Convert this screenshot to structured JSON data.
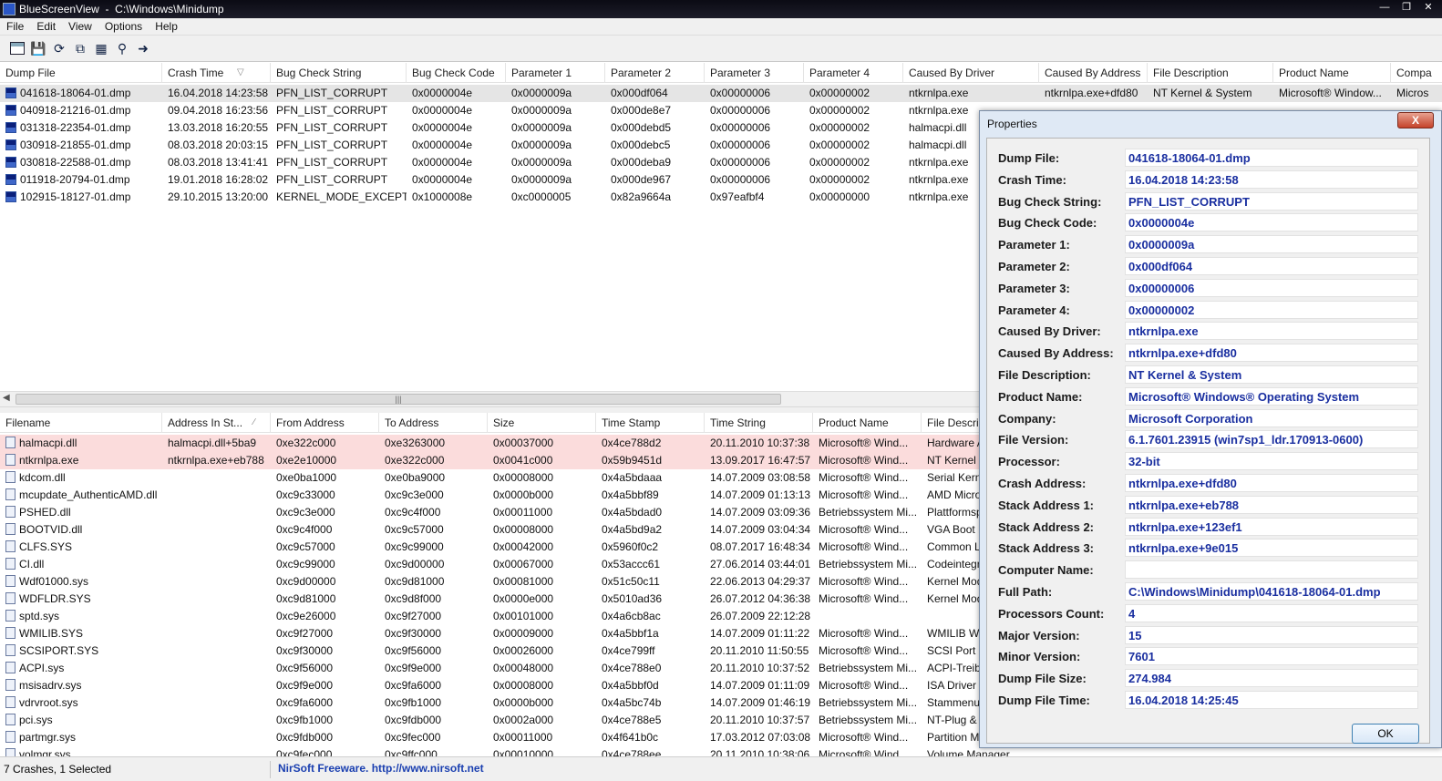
{
  "window": {
    "title": "BlueScreenView  -  C:\\Windows\\Minidump"
  },
  "menu": [
    "File",
    "Edit",
    "View",
    "Options",
    "Help"
  ],
  "toolbar_icons": [
    "properties-icon",
    "save-icon",
    "refresh-icon",
    "copy-icon",
    "report-icon",
    "find-icon",
    "exit-icon"
  ],
  "top_columns": [
    "Dump File",
    "Crash Time",
    "Bug Check String",
    "Bug Check Code",
    "Parameter 1",
    "Parameter 2",
    "Parameter 3",
    "Parameter 4",
    "Caused By Driver",
    "Caused By Address",
    "File Description",
    "Product Name",
    "Compa"
  ],
  "dumps": [
    [
      "041618-18064-01.dmp",
      "16.04.2018 14:23:58",
      "PFN_LIST_CORRUPT",
      "0x0000004e",
      "0x0000009a",
      "0x000df064",
      "0x00000006",
      "0x00000002",
      "ntkrnlpa.exe",
      "ntkrnlpa.exe+dfd80",
      "NT Kernel & System",
      "Microsoft® Window...",
      "Micros"
    ],
    [
      "040918-21216-01.dmp",
      "09.04.2018 16:23:56",
      "PFN_LIST_CORRUPT",
      "0x0000004e",
      "0x0000009a",
      "0x000de8e7",
      "0x00000006",
      "0x00000002",
      "ntkrnlpa.exe",
      "",
      "",
      "",
      ""
    ],
    [
      "031318-22354-01.dmp",
      "13.03.2018 16:20:55",
      "PFN_LIST_CORRUPT",
      "0x0000004e",
      "0x0000009a",
      "0x000debd5",
      "0x00000006",
      "0x00000002",
      "halmacpi.dll",
      "",
      "",
      "",
      ""
    ],
    [
      "030918-21855-01.dmp",
      "08.03.2018 20:03:15",
      "PFN_LIST_CORRUPT",
      "0x0000004e",
      "0x0000009a",
      "0x000debc5",
      "0x00000006",
      "0x00000002",
      "halmacpi.dll",
      "",
      "",
      "",
      ""
    ],
    [
      "030818-22588-01.dmp",
      "08.03.2018 13:41:41",
      "PFN_LIST_CORRUPT",
      "0x0000004e",
      "0x0000009a",
      "0x000deba9",
      "0x00000006",
      "0x00000002",
      "ntkrnlpa.exe",
      "",
      "",
      "",
      ""
    ],
    [
      "011918-20794-01.dmp",
      "19.01.2018 16:28:02",
      "PFN_LIST_CORRUPT",
      "0x0000004e",
      "0x0000009a",
      "0x000de967",
      "0x00000006",
      "0x00000002",
      "ntkrnlpa.exe",
      "",
      "",
      "",
      ""
    ],
    [
      "102915-18127-01.dmp",
      "29.10.2015 13:20:00",
      "KERNEL_MODE_EXCEPTI...",
      "0x1000008e",
      "0xc0000005",
      "0x82a9664a",
      "0x97eafbf4",
      "0x00000000",
      "ntkrnlpa.exe",
      "",
      "",
      "",
      ""
    ]
  ],
  "bottom_columns": [
    "Filename",
    "Address In St...",
    "From Address",
    "To Address",
    "Size",
    "Time Stamp",
    "Time String",
    "Product Name",
    "File Descrip"
  ],
  "drivers": [
    [
      "halmacpi.dll",
      "halmacpi.dll+5ba9",
      "0xe322c000",
      "0xe3263000",
      "0x00037000",
      "0x4ce788d2",
      "20.11.2010 10:37:38",
      "Microsoft® Wind...",
      "Hardware A"
    ],
    [
      "ntkrnlpa.exe",
      "ntkrnlpa.exe+eb788",
      "0xe2e10000",
      "0xe322c000",
      "0x0041c000",
      "0x59b9451d",
      "13.09.2017 16:47:57",
      "Microsoft® Wind...",
      "NT Kernel"
    ],
    [
      "kdcom.dll",
      "",
      "0xe0ba1000",
      "0xe0ba9000",
      "0x00008000",
      "0x4a5bdaaa",
      "14.07.2009 03:08:58",
      "Microsoft® Wind...",
      "Serial Kerne"
    ],
    [
      "mcupdate_AuthenticAMD.dll",
      "",
      "0xc9c33000",
      "0xc9c3e000",
      "0x0000b000",
      "0x4a5bbf89",
      "14.07.2009 01:13:13",
      "Microsoft® Wind...",
      "AMD Micro"
    ],
    [
      "PSHED.dll",
      "",
      "0xc9c3e000",
      "0xc9c4f000",
      "0x00011000",
      "0x4a5bdad0",
      "14.07.2009 03:09:36",
      "Betriebssystem Mi...",
      "Plattformsp"
    ],
    [
      "BOOTVID.dll",
      "",
      "0xc9c4f000",
      "0xc9c57000",
      "0x00008000",
      "0x4a5bd9a2",
      "14.07.2009 03:04:34",
      "Microsoft® Wind...",
      "VGA Boot D"
    ],
    [
      "CLFS.SYS",
      "",
      "0xc9c57000",
      "0xc9c99000",
      "0x00042000",
      "0x5960f0c2",
      "08.07.2017 16:48:34",
      "Microsoft® Wind...",
      "Common L"
    ],
    [
      "CI.dll",
      "",
      "0xc9c99000",
      "0xc9d00000",
      "0x00067000",
      "0x53accc61",
      "27.06.2014 03:44:01",
      "Betriebssystem Mi...",
      "Codeintegr"
    ],
    [
      "Wdf01000.sys",
      "",
      "0xc9d00000",
      "0xc9d81000",
      "0x00081000",
      "0x51c50c11",
      "22.06.2013 04:29:37",
      "Microsoft® Wind...",
      "Kernel Mod"
    ],
    [
      "WDFLDR.SYS",
      "",
      "0xc9d81000",
      "0xc9d8f000",
      "0x0000e000",
      "0x5010ad36",
      "26.07.2012 04:36:38",
      "Microsoft® Wind...",
      "Kernel Mod"
    ],
    [
      "sptd.sys",
      "",
      "0xc9e26000",
      "0xc9f27000",
      "0x00101000",
      "0x4a6cb8ac",
      "26.07.2009 22:12:28",
      "",
      ""
    ],
    [
      "WMILIB.SYS",
      "",
      "0xc9f27000",
      "0xc9f30000",
      "0x00009000",
      "0x4a5bbf1a",
      "14.07.2009 01:11:22",
      "Microsoft® Wind...",
      "WMILIB WI"
    ],
    [
      "SCSIPORT.SYS",
      "",
      "0xc9f30000",
      "0xc9f56000",
      "0x00026000",
      "0x4ce799ff",
      "20.11.2010 11:50:55",
      "Microsoft® Wind...",
      "SCSI Port D"
    ],
    [
      "ACPI.sys",
      "",
      "0xc9f56000",
      "0xc9f9e000",
      "0x00048000",
      "0x4ce788e0",
      "20.11.2010 10:37:52",
      "Betriebssystem Mi...",
      "ACPI-Treib"
    ],
    [
      "msisadrv.sys",
      "",
      "0xc9f9e000",
      "0xc9fa6000",
      "0x00008000",
      "0x4a5bbf0d",
      "14.07.2009 01:11:09",
      "Microsoft® Wind...",
      "ISA Driver"
    ],
    [
      "vdrvroot.sys",
      "",
      "0xc9fa6000",
      "0xc9fb1000",
      "0x0000b000",
      "0x4a5bc74b",
      "14.07.2009 01:46:19",
      "Betriebssystem Mi...",
      "Stammenu"
    ],
    [
      "pci.sys",
      "",
      "0xc9fb1000",
      "0xc9fdb000",
      "0x0002a000",
      "0x4ce788e5",
      "20.11.2010 10:37:57",
      "Betriebssystem Mi...",
      "NT-Plug &"
    ],
    [
      "partmgr.sys",
      "",
      "0xc9fdb000",
      "0xc9fec000",
      "0x00011000",
      "0x4f641b0c",
      "17.03.2012 07:03:08",
      "Microsoft® Wind...",
      "Partition M"
    ],
    [
      "volmgr.sys",
      "",
      "0xc9fec000",
      "0xc9ffc000",
      "0x00010000",
      "0x4ce788ee",
      "20.11.2010 10:38:06",
      "Microsoft® Wind...",
      "Volume Manager"
    ]
  ],
  "status": {
    "count": "7 Crashes, 1 Selected",
    "link": "NirSoft Freeware.  http://www.nirsoft.net"
  },
  "dialog": {
    "title": "Properties",
    "close": "X",
    "ok": "OK",
    "props": [
      {
        "label": "Dump File:",
        "value": "041618-18064-01.dmp"
      },
      {
        "label": "Crash Time:",
        "value": "16.04.2018 14:23:58"
      },
      {
        "label": "Bug Check String:",
        "value": "PFN_LIST_CORRUPT"
      },
      {
        "label": "Bug Check Code:",
        "value": "0x0000004e"
      },
      {
        "label": "Parameter 1:",
        "value": "0x0000009a"
      },
      {
        "label": "Parameter 2:",
        "value": "0x000df064"
      },
      {
        "label": "Parameter 3:",
        "value": "0x00000006"
      },
      {
        "label": "Parameter 4:",
        "value": "0x00000002"
      },
      {
        "label": "Caused By Driver:",
        "value": "ntkrnlpa.exe"
      },
      {
        "label": "Caused By Address:",
        "value": "ntkrnlpa.exe+dfd80"
      },
      {
        "label": "File Description:",
        "value": "NT Kernel & System"
      },
      {
        "label": "Product Name:",
        "value": "Microsoft® Windows® Operating System"
      },
      {
        "label": "Company:",
        "value": "Microsoft Corporation"
      },
      {
        "label": "File Version:",
        "value": "6.1.7601.23915 (win7sp1_ldr.170913-0600)"
      },
      {
        "label": "Processor:",
        "value": "32-bit"
      },
      {
        "label": "Crash Address:",
        "value": "ntkrnlpa.exe+dfd80"
      },
      {
        "label": "Stack Address 1:",
        "value": "ntkrnlpa.exe+eb788"
      },
      {
        "label": "Stack Address 2:",
        "value": "ntkrnlpa.exe+123ef1"
      },
      {
        "label": "Stack Address 3:",
        "value": "ntkrnlpa.exe+9e015"
      },
      {
        "label": "Computer Name:",
        "value": ""
      },
      {
        "label": "Full Path:",
        "value": "C:\\Windows\\Minidump\\041618-18064-01.dmp"
      },
      {
        "label": "Processors Count:",
        "value": "4"
      },
      {
        "label": "Major Version:",
        "value": "15"
      },
      {
        "label": "Minor Version:",
        "value": "7601"
      },
      {
        "label": "Dump File Size:",
        "value": "274.984"
      },
      {
        "label": "Dump File Time:",
        "value": "16.04.2018 14:25:45"
      }
    ]
  },
  "colors": {
    "selected_row": "#e5e5e5",
    "highlight_row": "#fbdcdc",
    "value_text": "#1a2fa0",
    "link": "#1a3fb0"
  }
}
